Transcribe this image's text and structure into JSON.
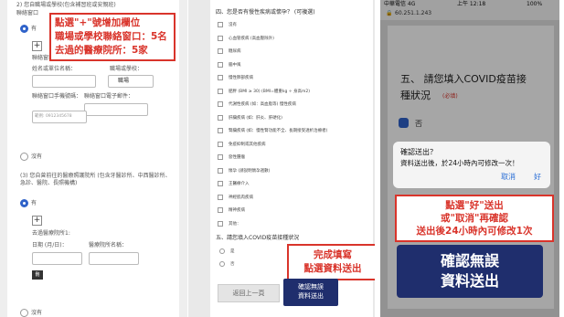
{
  "panel1": {
    "q2_title": "2) 您自職場或學校(包含補習班或安親班)",
    "q2_sub": "聯絡窗口",
    "annotation": [
      "點選\"+\"號增加欄位",
      "職場或學校聯絡窗口：5名",
      "去過的醫療院所：5家"
    ],
    "yes": "有",
    "no": "沒有",
    "contact_label": "聯絡窗口1:",
    "unit_label": "姓名或單位名稱：",
    "title_label": "職場或學校：",
    "title_value": "職場",
    "phone_label": "聯絡窗口手機號碼：",
    "email_label": "聯絡窗口電子郵件：",
    "phone_placeholder": "範例: 0912345678",
    "q3_title": "(3) 您自曾前往的醫療照護院所 (包含牙醫診所、中西醫診所、急診、醫院、長照機構)",
    "clinic_label": "去過醫療院所1:",
    "date_label": "日期 (月/日)：",
    "clinic_name_label": "醫療院所名稱："
  },
  "panel2": {
    "q4_title": "四、您是否有慢性疾病或懷孕？ (可複選)",
    "options": [
      "沒有",
      "心血管疾病 (高血壓除外)",
      "糖尿病",
      "腦中風",
      "慢性肺部疾病",
      "肥胖 (BMI ≥ 30) (BMI=體重kg ÷ 身高m2)",
      "代謝性疾病 (如：高血脂等) 慢性疾病",
      "肝臟疾病 (如：肝炎、肝硬化)",
      "腎臟疾病 (如：慢性腎功能不全、長期接受透析治療者)",
      "免疫抑制或其他疾病",
      "惡性腫瘤",
      "懷孕 (請說明懷孕週數)",
      "王醫療介入",
      "神經肌肉疾病",
      "精神疾病",
      "其他："
    ],
    "q5_title": "五、請您填入COVID疫苗接種狀況",
    "q5_yes": "是",
    "q5_no": "否",
    "callout": [
      "完成填寫",
      "點選資料送出"
    ],
    "back_btn": "返回上一頁",
    "confirm_btn": [
      "確認無誤",
      "資料送出"
    ]
  },
  "panel3": {
    "status": {
      "carrier": "中華電信 4G",
      "time": "上午 12:18",
      "battery": "100%"
    },
    "url": "60.251.1.243",
    "q5_title_line1": "五、 請您填入COVID疫苗接",
    "q5_title_line2": "種狀況",
    "required": "(必填)",
    "no_label": "否",
    "alert_title": "確認送出？",
    "alert_body": "資料送出後，於24小時內可修改一次！",
    "cancel": "取消",
    "ok": "好",
    "annotation": [
      "點選\"好\"送出",
      "或\"取消\"再確認",
      "送出後24小時內可修改1次"
    ],
    "big_confirm": [
      "確認無誤",
      "資料送出"
    ]
  }
}
